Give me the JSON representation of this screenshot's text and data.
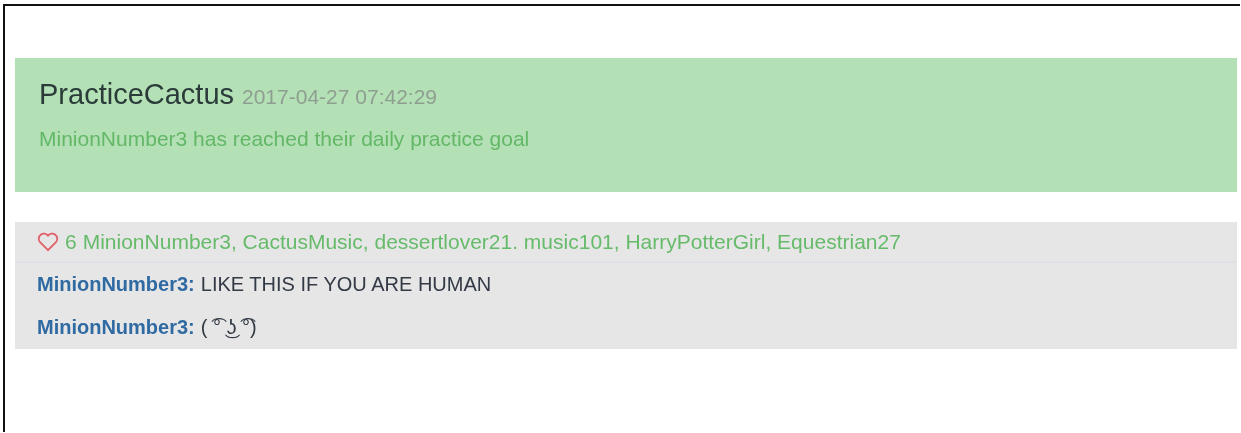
{
  "post": {
    "author": "PracticeCactus",
    "timestamp": "2017-04-27 07:42:29",
    "message": "MinionNumber3 has reached their daily practice goal"
  },
  "likes": {
    "count": "6",
    "liked": true,
    "names": "MinionNumber3, CactusMusic, dessertlover21. music101, HarryPotterGirl, Equestrian27"
  },
  "comments": [
    {
      "user": "MinionNumber3:",
      "text": "LIKE THIS IF YOU ARE HUMAN"
    },
    {
      "user": "MinionNumber3:",
      "text": "( ͡° ͜ʖ ͡°)"
    }
  ]
}
